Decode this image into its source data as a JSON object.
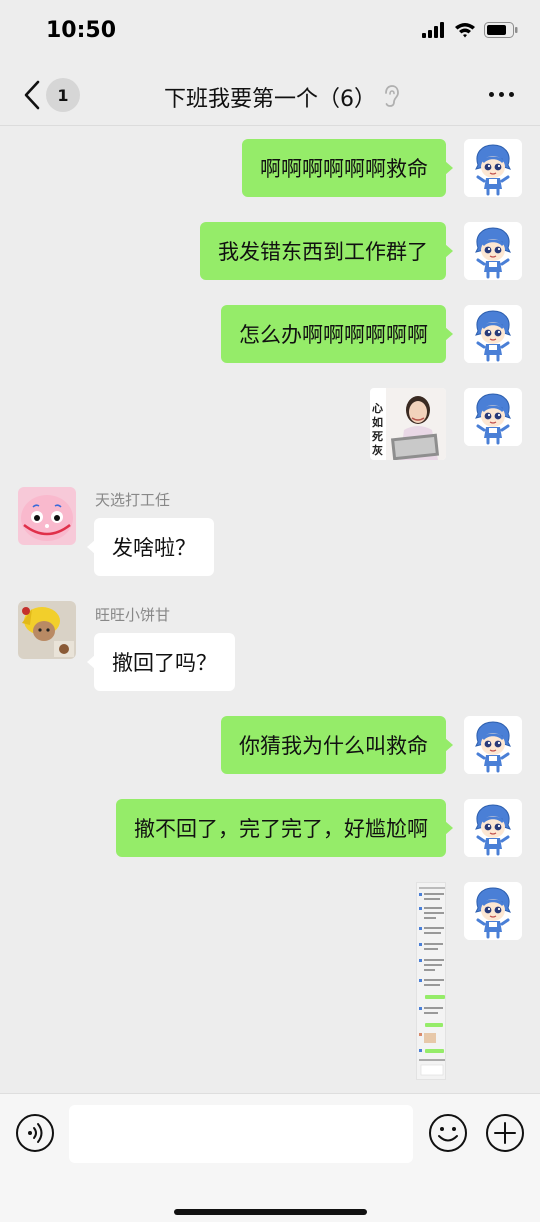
{
  "status_bar": {
    "time": "10:50",
    "icons": [
      "signal-icon",
      "wifi-icon",
      "battery-icon"
    ]
  },
  "nav": {
    "back_icon": "chevron-left-icon",
    "unread_badge": "1",
    "title": "下班我要第一个（6）",
    "mute_icon": "ear-mute-icon",
    "more_icon": "more-dots-icon"
  },
  "messages": [
    {
      "side": "out",
      "type": "text",
      "text": "啊啊啊啊啊啊救命"
    },
    {
      "side": "out",
      "type": "text",
      "text": "我发错东西到工作群了"
    },
    {
      "side": "out",
      "type": "text",
      "text": "怎么办啊啊啊啊啊啊"
    },
    {
      "side": "out",
      "type": "sticker",
      "text": "心如死灰"
    },
    {
      "side": "in",
      "type": "text",
      "sender": "天选打工任",
      "text": "发啥啦？"
    },
    {
      "side": "in",
      "type": "text",
      "sender": "旺旺小饼甘",
      "text": "撤回了吗？"
    },
    {
      "side": "out",
      "type": "text",
      "text": "你猜我为什么叫救命"
    },
    {
      "side": "out",
      "type": "text",
      "text": "撤不回了，完了完了，好尴尬啊"
    },
    {
      "side": "out",
      "type": "image",
      "text": ""
    }
  ],
  "input_bar": {
    "voice_icon": "voice-icon",
    "placeholder": "",
    "emoji_icon": "emoji-icon",
    "plus_icon": "plus-icon"
  },
  "colors": {
    "background": "#ededed",
    "bubble_out": "#95ec69",
    "bubble_in": "#ffffff",
    "self_avatar_hair": "#4a7fd6"
  }
}
